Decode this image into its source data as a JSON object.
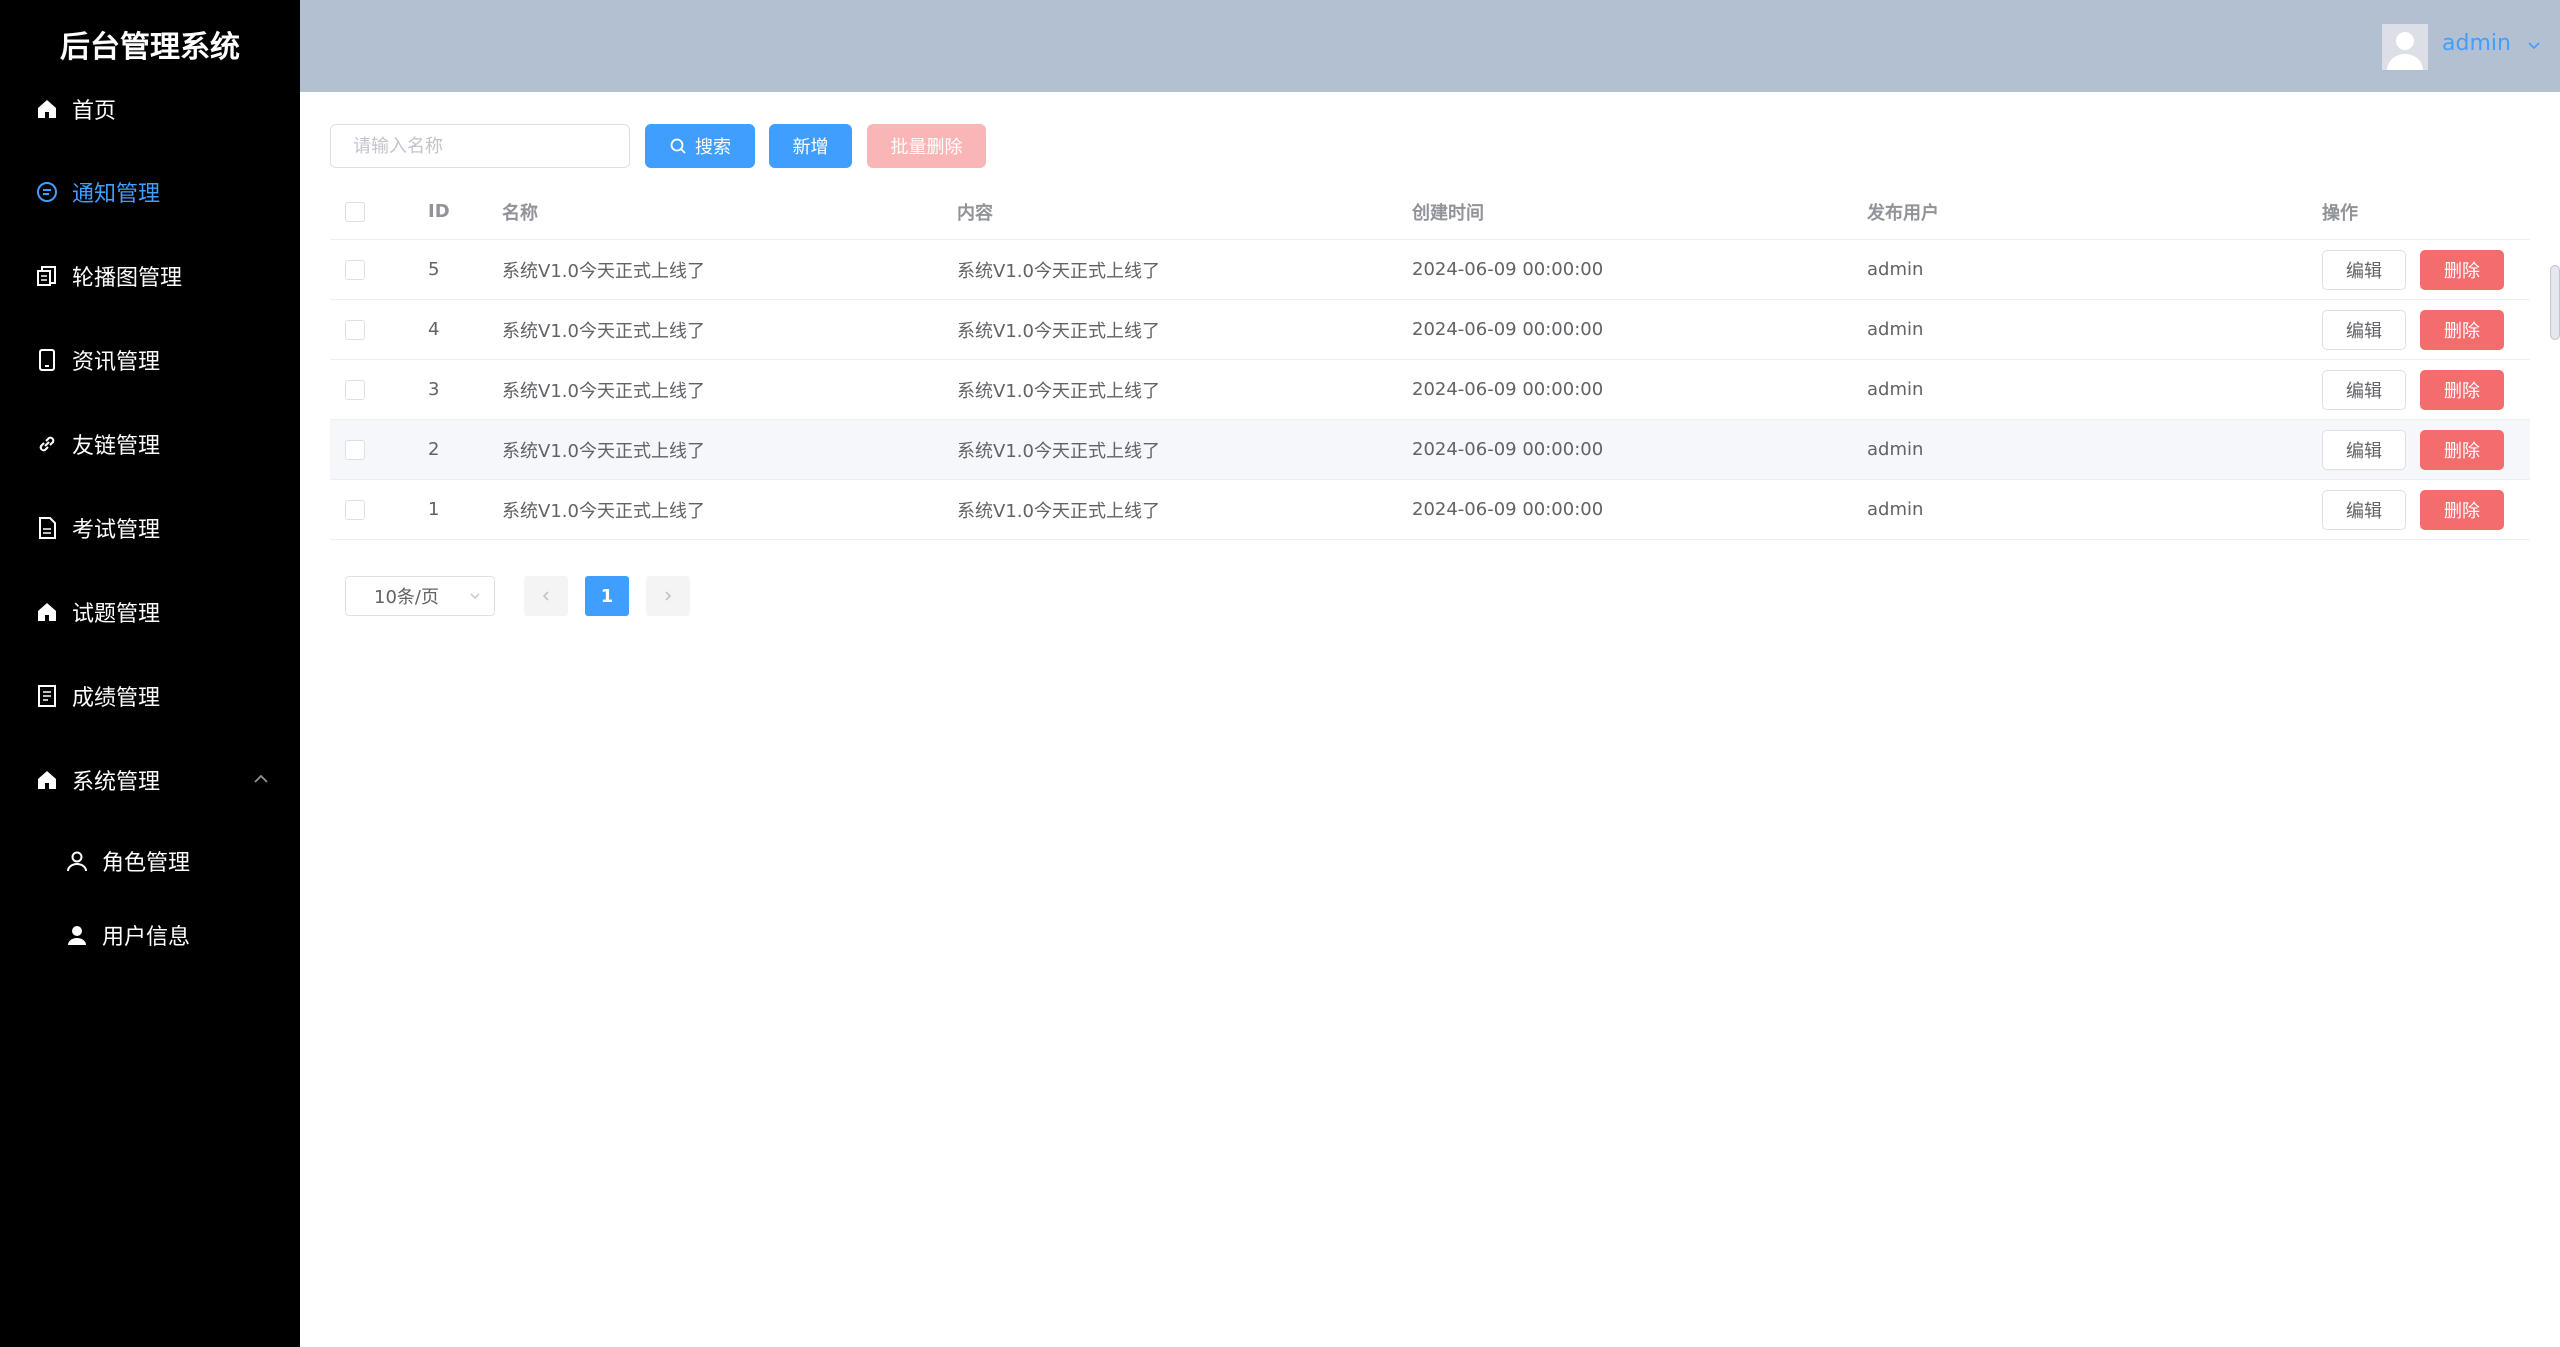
{
  "app": {
    "title": "后台管理系统"
  },
  "sidebar": {
    "items": [
      {
        "label": "首页",
        "icon": "home-icon"
      },
      {
        "label": "通知管理",
        "icon": "chat-icon",
        "active": true
      },
      {
        "label": "轮播图管理",
        "icon": "document-copy-icon"
      },
      {
        "label": "资讯管理",
        "icon": "mobile-icon"
      },
      {
        "label": "友链管理",
        "icon": "link-icon"
      },
      {
        "label": "考试管理",
        "icon": "document-icon"
      },
      {
        "label": "试题管理",
        "icon": "home-icon"
      },
      {
        "label": "成绩管理",
        "icon": "tickets-icon"
      },
      {
        "label": "系统管理",
        "icon": "home-icon",
        "expanded": true
      }
    ],
    "sub_items": [
      {
        "label": "角色管理",
        "icon": "user-outline-icon"
      },
      {
        "label": "用户信息",
        "icon": "user-solid-icon"
      }
    ]
  },
  "header": {
    "username": "admin"
  },
  "toolbar": {
    "search_placeholder": "请输入名称",
    "search_label": "搜索",
    "add_label": "新增",
    "bulk_delete_label": "批量删除"
  },
  "table": {
    "columns": [
      "ID",
      "名称",
      "内容",
      "创建时间",
      "发布用户",
      "操作"
    ],
    "rows": [
      {
        "id": "5",
        "name": "系统V1.0今天正式上线了",
        "content": "系统V1.0今天正式上线了",
        "time": "2024-06-09 00:00:00",
        "user": "admin"
      },
      {
        "id": "4",
        "name": "系统V1.0今天正式上线了",
        "content": "系统V1.0今天正式上线了",
        "time": "2024-06-09 00:00:00",
        "user": "admin"
      },
      {
        "id": "3",
        "name": "系统V1.0今天正式上线了",
        "content": "系统V1.0今天正式上线了",
        "time": "2024-06-09 00:00:00",
        "user": "admin"
      },
      {
        "id": "2",
        "name": "系统V1.0今天正式上线了",
        "content": "系统V1.0今天正式上线了",
        "time": "2024-06-09 00:00:00",
        "user": "admin"
      },
      {
        "id": "1",
        "name": "系统V1.0今天正式上线了",
        "content": "系统V1.0今天正式上线了",
        "time": "2024-06-09 00:00:00",
        "user": "admin"
      }
    ],
    "edit_label": "编辑",
    "delete_label": "删除"
  },
  "pagination": {
    "page_size": "10条/页",
    "current_page": "1"
  },
  "colors": {
    "sidebar_bg": "#000000",
    "header_bg": "#b3c0d1",
    "primary": "#409eff",
    "danger": "#f56c6c",
    "danger_light": "#fab6b6"
  }
}
